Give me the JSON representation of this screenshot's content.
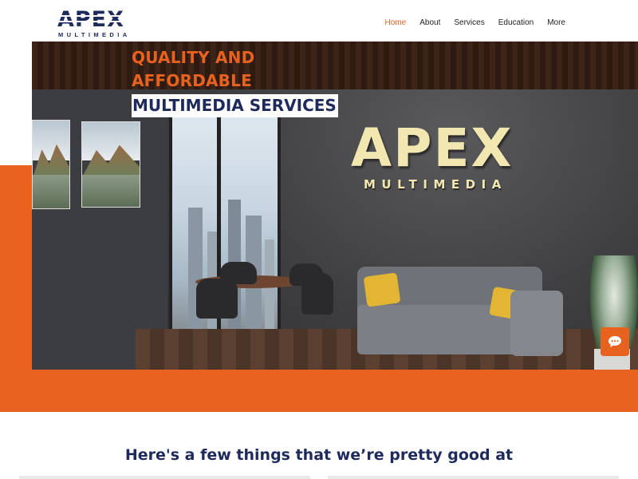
{
  "brand": {
    "logo_word": "APEX",
    "logo_sub": "MULTIMEDIA",
    "navy": "#1e2a5c",
    "orange": "#e8621f"
  },
  "nav": {
    "items": [
      {
        "label": "Home",
        "active": true
      },
      {
        "label": "About",
        "active": false
      },
      {
        "label": "Services",
        "active": false
      },
      {
        "label": "Education",
        "active": false
      },
      {
        "label": "More",
        "active": false
      }
    ]
  },
  "hero": {
    "line1": "QUALITY AND",
    "line2": "AFFORDABLE",
    "line3": "MULTIMEDIA SERVICES",
    "sign_word": "APEX",
    "sign_sub": "MULTIMEDIA"
  },
  "chat": {
    "icon": "chat-bubble-icon"
  },
  "section": {
    "title": "Here's a few things that we’re pretty good at"
  }
}
